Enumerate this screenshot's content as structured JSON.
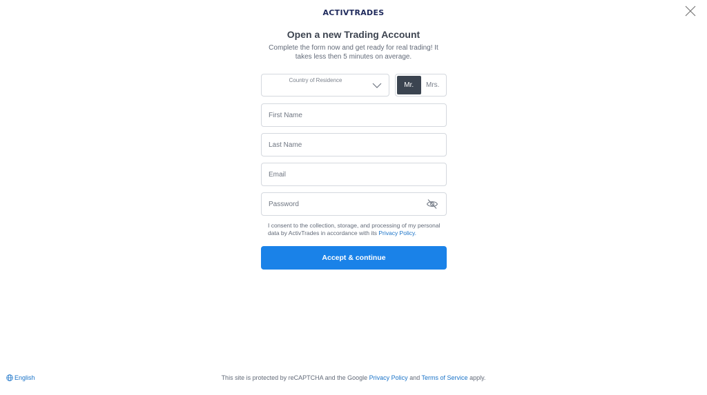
{
  "header": {
    "logo_text": "ACTIVTRADES"
  },
  "form": {
    "title": "Open a new Trading Account",
    "subtitle": "Complete the form now and get ready for real trading! It takes less then 5 minutes on average.",
    "country_label": "Country of Residence",
    "title_options": {
      "mr": "Mr.",
      "mrs": "Mrs.",
      "selected": "Mr."
    },
    "first_name_placeholder": "First Name",
    "last_name_placeholder": "Last Name",
    "email_placeholder": "Email",
    "password_placeholder": "Password",
    "consent_text": "I consent to the collection, storage, and processing of my personal data by ActivTrades in accordance with its ",
    "consent_link": "Privacy Policy.",
    "submit_label": "Accept & continue"
  },
  "footer": {
    "language": "English",
    "recaptcha_prefix": "This site is protected by reCAPTCHA and the Google ",
    "privacy_link": "Privacy Policy",
    "and_text": " and ",
    "terms_link": "Terms of Service",
    "suffix": " apply."
  },
  "colors": {
    "primary": "#1a82e8",
    "dark_toggle": "#3b4450",
    "link": "#1a73c8",
    "logo": "#1f2a5c"
  },
  "icons": [
    "close-icon",
    "chevron-down-icon",
    "eye-slash-icon",
    "globe-icon"
  ]
}
